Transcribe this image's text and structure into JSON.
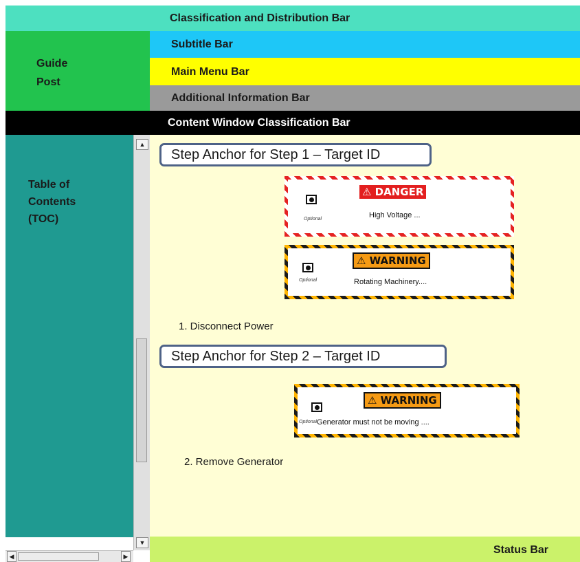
{
  "bars": {
    "classification": "Classification and Distribution Bar",
    "subtitle": "Subtitle Bar",
    "main_menu": "Main Menu Bar",
    "additional_info": "Additional Information Bar",
    "content_window_classification": "Content Window Classification Bar",
    "status": "Status Bar"
  },
  "guide_post": "Guide Post",
  "toc": {
    "label": "Table of Contents (TOC)"
  },
  "steps": [
    {
      "anchor": "Step Anchor for Step 1 – Target ID",
      "signs": [
        {
          "type": "danger",
          "header": "⚠ DANGER",
          "optional": "Optional",
          "message": "High Voltage ..."
        },
        {
          "type": "warning",
          "header": "⚠ WARNING",
          "optional": "Optional",
          "message": "Rotating  Machinery...."
        }
      ],
      "instruction": "1. Disconnect Power"
    },
    {
      "anchor": "Step Anchor for Step 2 – Target ID",
      "signs": [
        {
          "type": "warning",
          "header": "⚠ WARNING",
          "optional": "Optional",
          "message": "Generator must not be moving ...."
        }
      ],
      "instruction": "2. Remove Generator"
    }
  ],
  "scrollbar": {
    "up_icon": "arrow-up-icon",
    "down_icon": "arrow-down-icon",
    "left_icon": "arrow-left-icon",
    "right_icon": "arrow-right-icon"
  },
  "colors": {
    "classification_bar": "#4de0c0",
    "guide_post": "#22c34e",
    "subtitle_bar": "#1ec7f7",
    "main_menu_bar": "#ffff00",
    "additional_info_bar": "#9a9a9a",
    "content_class_bar": "#000000",
    "toc": "#1f9a91",
    "content_window": "#fffed5",
    "status_bar": "#cbf26a",
    "danger": "#e31f1f",
    "warning": "#f59a14"
  }
}
